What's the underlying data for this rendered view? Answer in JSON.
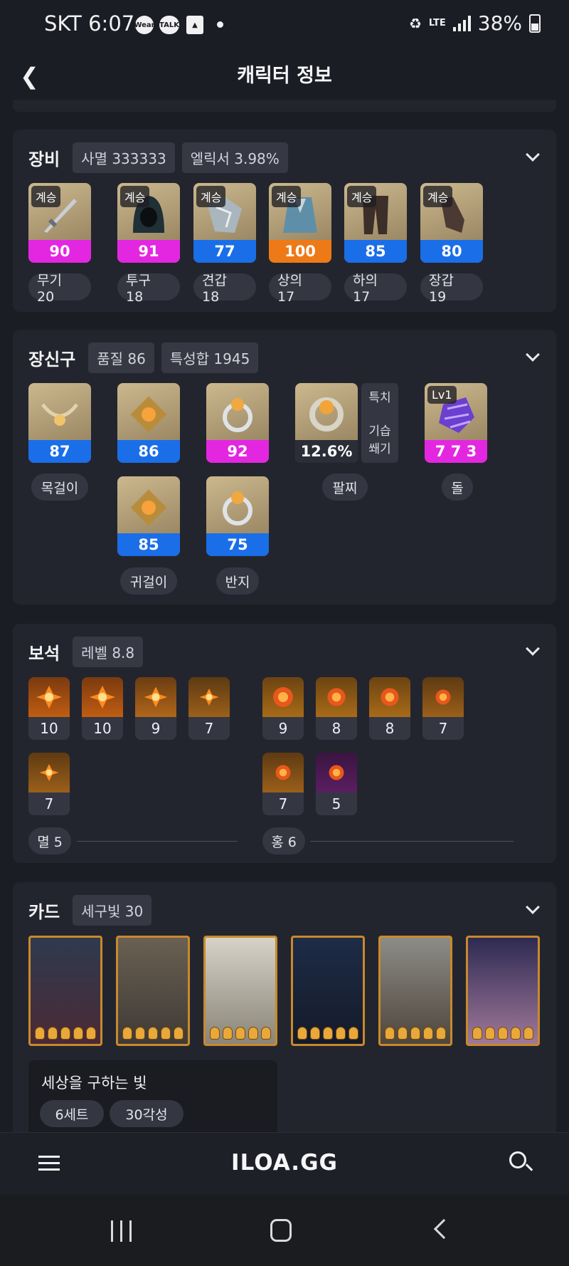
{
  "status": {
    "time": "SKT 6:07",
    "battery": "38%",
    "network": "LTE",
    "icons": [
      "wear-icon",
      "talk-icon",
      "contact-icon"
    ]
  },
  "header": {
    "title": "캐릭터 정보"
  },
  "equipment": {
    "title": "장비",
    "pills": [
      "사멸 333333",
      "엘릭서 3.98%"
    ],
    "items": [
      {
        "tag": "계승",
        "quality": "90",
        "label": "무기 20",
        "bar": "#e327e1"
      },
      {
        "tag": "계승",
        "quality": "91",
        "label": "투구 18",
        "bar": "#e327e1"
      },
      {
        "tag": "계승",
        "quality": "77",
        "label": "견갑 18",
        "bar": "#1a6ee8"
      },
      {
        "tag": "계승",
        "quality": "100",
        "label": "상의 17",
        "bar": "#ee7a17"
      },
      {
        "tag": "계승",
        "quality": "85",
        "label": "하의 17",
        "bar": "#1a6ee8"
      },
      {
        "tag": "계승",
        "quality": "80",
        "label": "장갑 19",
        "bar": "#1a6ee8"
      }
    ]
  },
  "accessories": {
    "title": "장신구",
    "pills": [
      "품질 86",
      "특성합 1945"
    ],
    "necklace": {
      "quality": "87",
      "label": "목걸이"
    },
    "earrings": [
      {
        "quality": "86"
      },
      {
        "quality": "85"
      }
    ],
    "earring_label": "귀걸이",
    "rings": [
      {
        "quality": "92"
      },
      {
        "quality": "75"
      }
    ],
    "ring_label": "반지",
    "bracelet": {
      "value": "12.6%",
      "stats": [
        "특치",
        "기습",
        "쐐기"
      ],
      "label": "팔찌"
    },
    "stone": {
      "level": "Lv1",
      "value": "7 7 3",
      "label": "돌"
    }
  },
  "gems": {
    "title": "보석",
    "pills": [
      "레벨 8.8"
    ],
    "left_row1": [
      "10",
      "10",
      "9",
      "7"
    ],
    "left_row2": [
      "7"
    ],
    "right_row1": [
      "9",
      "8",
      "8",
      "7"
    ],
    "right_row2": [
      "7",
      "5"
    ],
    "left_label": "멸 5",
    "right_label": "홍 6"
  },
  "cards": {
    "title": "카드",
    "pills": [
      "세구빛 30"
    ],
    "set_name": "세상을 구하는 빛",
    "set_tags": [
      "6세트",
      "30각성"
    ]
  },
  "navbar": {
    "logo": "ILOA.GG"
  }
}
